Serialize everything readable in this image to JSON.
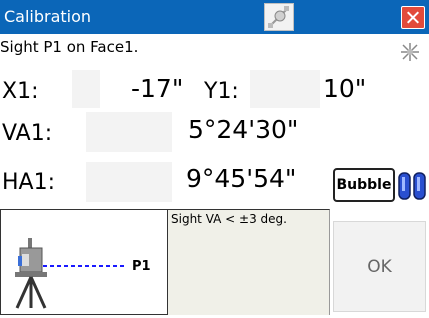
{
  "window": {
    "title": "Calibration",
    "close_label": "×"
  },
  "instruction": "Sight P1 on Face1.",
  "readings": {
    "x1_label": "X1:",
    "x1_value": "-17\"",
    "y1_label": "Y1:",
    "y1_value": "10\"",
    "va1_label": "VA1:",
    "va1_value": "5°24'30\"",
    "ha1_label": "HA1:",
    "ha1_value": "9°45'54\""
  },
  "buttons": {
    "bubble_label": "Bubble",
    "ok_label": "OK"
  },
  "diagram": {
    "target_label": "P1"
  },
  "note": "Sight VA < ±3 deg.",
  "icons": {
    "title_icon": "prism-target-icon",
    "laser_icon": "laser-pointer-icon",
    "bubble_icon": "level-vial-icon",
    "instrument_icon": "total-station-icon"
  },
  "colors": {
    "titlebar": "#0b66b8",
    "close": "#e24a3a",
    "sight_line": "#1a1aff"
  }
}
